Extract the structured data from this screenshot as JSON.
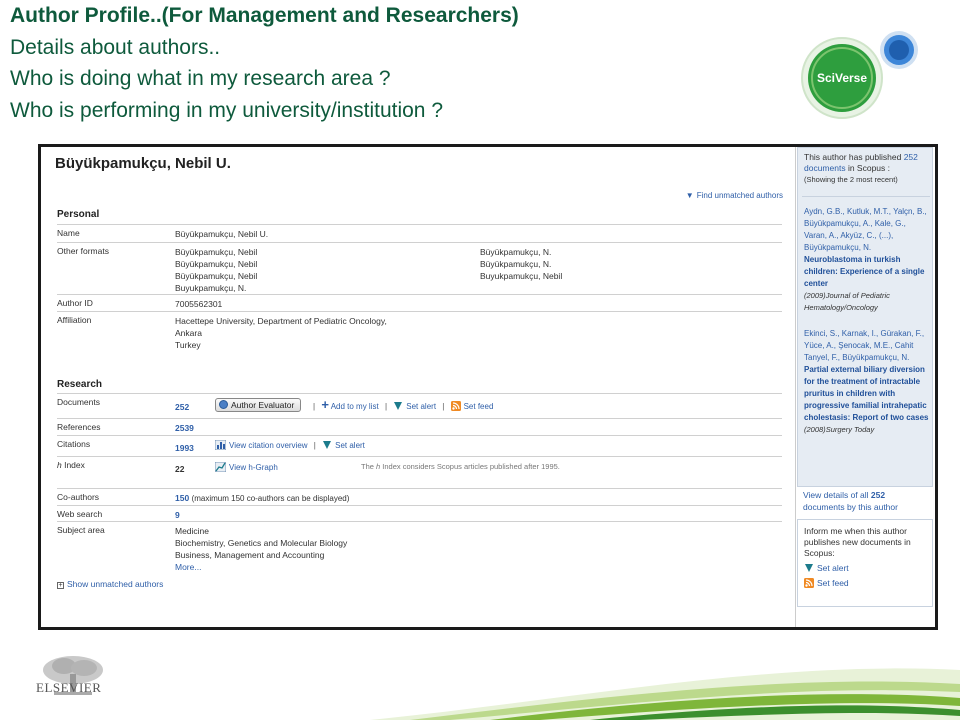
{
  "slide": {
    "title": "Author Profile..(For Management and Researchers)",
    "line1": "Details about authors..",
    "line2": "Who is doing what in my research area ?",
    "line3": "Who is performing in my university/institution ?",
    "logo_text": "SciVerse",
    "publisher": "ELSEVIER"
  },
  "colors": {
    "title_green": "#0e5a3c",
    "link_blue": "#2f5fa8",
    "logo_green": "#2e9e3e",
    "logo_blue": "#3d86d8"
  },
  "profile": {
    "author_name": "Büyükpamukçu, Nebil U.",
    "find_unmatched": "Find unmatched authors",
    "personal_title": "Personal",
    "name_label": "Name",
    "name_value": "Büyükpamukçu, Nebil U.",
    "other_formats_label": "Other formats",
    "other_formats_col1": [
      "Büyükpamukçu, Nebil",
      "Büyükpamukçu, Nebil",
      "Büyükpamukçu, Nebil",
      "Buyukpamukçu, N."
    ],
    "other_formats_col2": [
      "Büyükpamukçu, N.",
      "Büyükpamukçu, N.",
      "Buyukpamukçu, Nebil"
    ],
    "author_id_label": "Author ID",
    "author_id_value": "7005562301",
    "affiliation_label": "Affiliation",
    "affiliation_lines": [
      "Hacettepe University, Department of Pediatric Oncology,",
      "Ankara",
      "Turkey"
    ],
    "research_title": "Research",
    "documents_label": "Documents",
    "documents_value": "252",
    "author_evaluator": "Author Evaluator",
    "add_to_list": "Add to my list",
    "set_alert": "Set alert",
    "set_feed": "Set feed",
    "references_label": "References",
    "references_value": "2539",
    "citations_label": "Citations",
    "citations_value": "1993",
    "view_citation_overview": "View citation overview",
    "citations_set_alert": "Set alert",
    "h_prefix": "h",
    "h_index_label": " Index",
    "h_index_value": "22",
    "view_h_graph": "View h-Graph",
    "h_note_a": "The ",
    "h_note_h": "h",
    "h_note_b": " Index considers Scopus articles published after 1995.",
    "coauthors_label": "Co-authors",
    "coauthors_value": "150",
    "coauthors_note": "(maximum 150 co-authors can be displayed)",
    "web_search_label": "Web search",
    "web_search_value": "9",
    "subject_area_label": "Subject area",
    "subject_areas": [
      "Medicine",
      "Biochemistry, Genetics and Molecular Biology",
      "Business, Management and Accounting"
    ],
    "more": "More...",
    "show_unmatched": "Show unmatched authors"
  },
  "sidebar": {
    "intro_a": "This author has published ",
    "intro_count": "252",
    "intro_b": "documents",
    "intro_c": " in Scopus :",
    "intro_note": "(Showing the 2 most recent)",
    "pub1": {
      "authors": "Aydn, G.B., Kutluk, M.T., Yalçn, B., Büyükpamukçu, A., Kale, G., Varan, A., Akyüz, C., (...), Büyükpamukçu, N.",
      "title": "Neuroblastoma in turkish children: Experience of a single center",
      "year": "(2009)",
      "source": "Journal of Pediatric Hematology/Oncology"
    },
    "pub2": {
      "authors": "Ekinci, S., Karnak, I., Gürakan, F., Yüce, A., Şenocak, M.E., Cahit Tanyel, F., Büyükpamukçu, N.",
      "title": "Partial external biliary diversion for the treatment of intractable pruritus in children with progressive familial intrahepatic cholestasis: Report of two cases",
      "year": "(2008)",
      "source": "Surgery Today"
    },
    "view_all_a": "View details of all ",
    "view_all_count": "252",
    "view_all_b": " documents by this author",
    "inform_text": "Inform me when this author publishes new documents in Scopus:",
    "set_alert": "Set alert",
    "set_feed": "Set feed"
  }
}
